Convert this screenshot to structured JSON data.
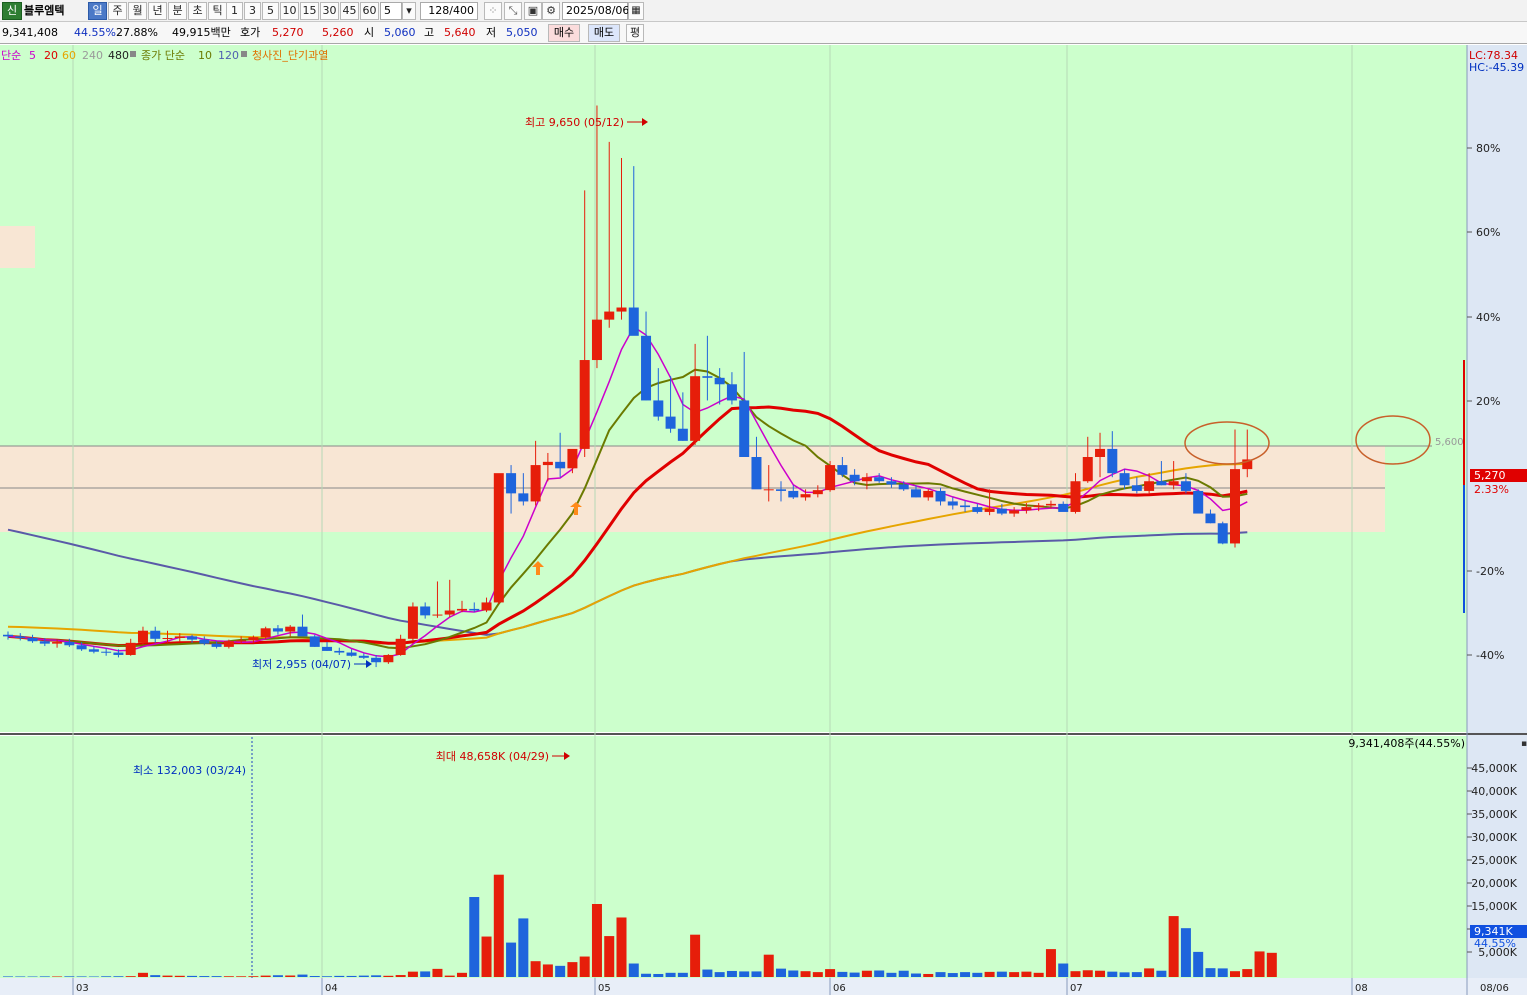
{
  "toolbar": {
    "market_badge": "신",
    "stock_name": "블루엠텍",
    "periods": [
      "일",
      "주",
      "월",
      "년",
      "분",
      "초",
      "틱"
    ],
    "active_period": "일",
    "intervals": [
      "1",
      "3",
      "5",
      "10",
      "15",
      "30",
      "45",
      "60"
    ],
    "interval_select": "5",
    "count": "128/400",
    "date": "2025/08/06"
  },
  "quote": {
    "volume": "9,341,408",
    "turnover_pct": "44.55%",
    "change_pct": "27.88%",
    "amount": "49,915백만",
    "hoga_label": "호가",
    "ask": "5,270",
    "bid": "5,260",
    "open_label": "시",
    "open": "5,060",
    "high_label": "고",
    "high": "5,640",
    "low_label": "저",
    "low": "5,050",
    "buy_btn": "매수",
    "sell_btn": "매도",
    "eval_btn": "평"
  },
  "legend": {
    "ma_label": "단순",
    "ma_periods": [
      {
        "p": "5",
        "color": "#cc00cc"
      },
      {
        "p": "20",
        "color": "#dd0000"
      },
      {
        "p": "60",
        "color": "#e6a500"
      },
      {
        "p": "240",
        "color": "#9a9a9a"
      },
      {
        "p": "480",
        "color": "#222222"
      }
    ],
    "close_ma_label": "종가 단순",
    "close_ma_periods": [
      {
        "p": "10",
        "color": "#6b7a00"
      },
      {
        "p": "120",
        "color": "#4f5fb0"
      }
    ],
    "signal_label": "청사진_단기과열",
    "signal_color": "#e07000"
  },
  "chart_data": {
    "type": "candlestick",
    "price_axis": {
      "ticks": [
        "80%",
        "60%",
        "40%",
        "20%",
        "-20%",
        "-40%"
      ],
      "lc": "LC:78.34",
      "hc": "HC:-45.39"
    },
    "current_price": "5,270",
    "current_change": "2.33%",
    "resistance_label": "5,600",
    "high_annotation": "최고 9,650 (05/12)",
    "low_annotation": "최저 2,955 (04/07)",
    "dates": [
      "03",
      "04",
      "05",
      "06",
      "07",
      "08",
      "08/06"
    ],
    "candles": [
      [
        3100,
        3140,
        3040,
        3080
      ],
      [
        3080,
        3120,
        3030,
        3060
      ],
      [
        3060,
        3100,
        3000,
        3020
      ],
      [
        3020,
        3060,
        2960,
        2990
      ],
      [
        2990,
        3040,
        2940,
        3010
      ],
      [
        3010,
        3050,
        2950,
        2970
      ],
      [
        2970,
        3010,
        2900,
        2920
      ],
      [
        2920,
        2960,
        2870,
        2890
      ],
      [
        2890,
        2930,
        2840,
        2880
      ],
      [
        2880,
        2920,
        2820,
        2850
      ],
      [
        2850,
        3050,
        2840,
        3000
      ],
      [
        3000,
        3200,
        2980,
        3150
      ],
      [
        3150,
        3200,
        3000,
        3050
      ],
      [
        3050,
        3150,
        3000,
        3060
      ],
      [
        3060,
        3120,
        3010,
        3080
      ],
      [
        3080,
        3100,
        3000,
        3040
      ],
      [
        3040,
        3080,
        2970,
        2990
      ],
      [
        2990,
        3020,
        2930,
        2950
      ],
      [
        2950,
        3040,
        2930,
        3020
      ],
      [
        3020,
        3080,
        2990,
        3030
      ],
      [
        3030,
        3090,
        3000,
        3070
      ],
      [
        3070,
        3200,
        3050,
        3180
      ],
      [
        3180,
        3220,
        3100,
        3140
      ],
      [
        3140,
        3220,
        3080,
        3200
      ],
      [
        3200,
        3350,
        3180,
        3080
      ],
      [
        3080,
        3100,
        2950,
        2950
      ],
      [
        2950,
        3010,
        2900,
        2900
      ],
      [
        2900,
        2940,
        2850,
        2880
      ],
      [
        2880,
        2920,
        2830,
        2840
      ],
      [
        2840,
        2870,
        2800,
        2815
      ],
      [
        2815,
        2850,
        2700,
        2760
      ],
      [
        2760,
        2860,
        2740,
        2850
      ],
      [
        2850,
        3100,
        2840,
        3050
      ],
      [
        3050,
        3500,
        3030,
        3450
      ],
      [
        3450,
        3500,
        3300,
        3340
      ],
      [
        3340,
        3760,
        3310,
        3350
      ],
      [
        3350,
        3780,
        3320,
        3400
      ],
      [
        3400,
        3520,
        3380,
        3420
      ],
      [
        3420,
        3500,
        3380,
        3400
      ],
      [
        3400,
        3560,
        3380,
        3500
      ],
      [
        3500,
        4800,
        3480,
        5100
      ],
      [
        5100,
        5200,
        4600,
        4850
      ],
      [
        4850,
        5100,
        4700,
        4750
      ],
      [
        4750,
        5500,
        4700,
        5200
      ],
      [
        5200,
        5350,
        5000,
        5240
      ],
      [
        5240,
        5600,
        5050,
        5160
      ],
      [
        5160,
        5300,
        5100,
        5400
      ],
      [
        5400,
        8600,
        5300,
        6500
      ],
      [
        6500,
        9650,
        6400,
        7000
      ],
      [
        7000,
        9200,
        6900,
        7100
      ],
      [
        7100,
        9000,
        7000,
        7150
      ],
      [
        7150,
        8900,
        7000,
        6800
      ],
      [
        6800,
        7100,
        6000,
        6000
      ],
      [
        6000,
        6400,
        5750,
        5800
      ],
      [
        5800,
        6300,
        5600,
        5650
      ],
      [
        5650,
        6100,
        5500,
        5500
      ],
      [
        5500,
        6700,
        5450,
        6300
      ],
      [
        6300,
        6800,
        6000,
        6280
      ],
      [
        6280,
        6400,
        5950,
        6200
      ],
      [
        6200,
        6350,
        5950,
        6000
      ],
      [
        6000,
        6600,
        5700,
        5300
      ],
      [
        5300,
        5550,
        5000,
        4900
      ],
      [
        4900,
        5200,
        4750,
        4900
      ],
      [
        4900,
        5000,
        4750,
        4880
      ],
      [
        4880,
        4950,
        4780,
        4800
      ],
      [
        4800,
        4900,
        4760,
        4840
      ],
      [
        4840,
        4950,
        4800,
        4890
      ],
      [
        4890,
        5250,
        4870,
        5200
      ],
      [
        5200,
        5300,
        5050,
        5080
      ],
      [
        5080,
        5150,
        4950,
        5000
      ],
      [
        5000,
        5100,
        4900,
        5050
      ],
      [
        5050,
        5100,
        4980,
        5000
      ],
      [
        5000,
        5050,
        4920,
        4960
      ],
      [
        4960,
        5000,
        4880,
        4900
      ],
      [
        4900,
        4950,
        4800,
        4800
      ],
      [
        4800,
        4900,
        4760,
        4880
      ],
      [
        4880,
        4920,
        4700,
        4750
      ],
      [
        4750,
        4800,
        4650,
        4700
      ],
      [
        4700,
        4760,
        4620,
        4680
      ],
      [
        4680,
        4720,
        4600,
        4620
      ],
      [
        4620,
        4900,
        4580,
        4660
      ],
      [
        4660,
        4720,
        4580,
        4600
      ],
      [
        4600,
        4680,
        4560,
        4640
      ],
      [
        4640,
        4730,
        4600,
        4680
      ],
      [
        4680,
        4730,
        4630,
        4700
      ],
      [
        4700,
        4760,
        4660,
        4720
      ],
      [
        4720,
        4750,
        4650,
        4620
      ],
      [
        4620,
        5100,
        4600,
        5000
      ],
      [
        5000,
        5550,
        4980,
        5300
      ],
      [
        5300,
        5600,
        5050,
        5400
      ],
      [
        5400,
        5620,
        5050,
        5100
      ],
      [
        5100,
        5150,
        4900,
        4950
      ],
      [
        4950,
        5050,
        4850,
        4880
      ],
      [
        4880,
        5100,
        4850,
        5000
      ],
      [
        5000,
        5250,
        4950,
        4950
      ],
      [
        4950,
        5250,
        4900,
        5000
      ],
      [
        5000,
        5100,
        4850,
        4880
      ],
      [
        4880,
        4900,
        4650,
        4600
      ],
      [
        4600,
        4650,
        4480,
        4480
      ],
      [
        4480,
        4500,
        4220,
        4230
      ],
      [
        4230,
        5640,
        4180,
        5150
      ],
      [
        5150,
        5640,
        5050,
        5270
      ]
    ],
    "volumes": [
      120,
      110,
      100,
      130,
      110,
      140,
      120,
      100,
      150,
      160,
      180,
      900,
      400,
      300,
      260,
      240,
      200,
      190,
      160,
      150,
      170,
      300,
      380,
      320,
      520,
      210,
      160,
      240,
      230,
      300,
      360,
      260,
      420,
      1150,
      1200,
      1750,
      300,
      900,
      17200,
      8700,
      22000,
      7400,
      12600,
      3400,
      2700,
      2400,
      3200,
      4400,
      15700,
      8800,
      12800,
      2900,
      700,
      650,
      900,
      900,
      9100,
      1600,
      1050,
      1300,
      1200,
      1200,
      4800,
      1800,
      1400,
      1250,
      1050,
      1700,
      1100,
      950,
      1350,
      1400,
      900,
      1350,
      750,
      650,
      1050,
      850,
      1050,
      900,
      1100,
      1150,
      1050,
      1150,
      900,
      6000,
      2900,
      1250,
      1450,
      1350,
      1150,
      1000,
      1050,
      1850,
      1350,
      13100,
      10500,
      5400,
      1900,
      1850,
      1250,
      1700,
      5500,
      5200
    ],
    "volume_axis": {
      "ticks": [
        "45,000K",
        "40,000K",
        "35,000K",
        "30,000K",
        "25,000K",
        "20,000K",
        "15,000K",
        "10,000K",
        "5,000K"
      ],
      "current": "9,341K",
      "current_pct": "44.55%",
      "header": "9,341,408주(44.55%)",
      "min_annotation": "최소 132,003 (03/24)",
      "max_annotation": "최대 48,658K (04/29)"
    }
  }
}
